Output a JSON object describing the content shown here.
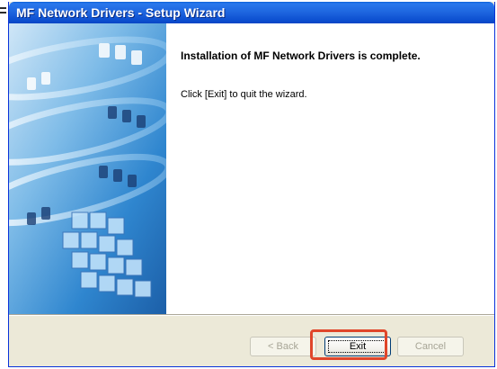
{
  "window": {
    "title": "MF Network Drivers - Setup Wizard"
  },
  "main": {
    "heading": "Installation of MF Network Drivers is complete.",
    "message": "Click [Exit] to quit the wizard."
  },
  "buttons": {
    "back": {
      "label": "< Back",
      "enabled": false
    },
    "exit": {
      "label": "Exit",
      "enabled": true,
      "focused": true
    },
    "cancel": {
      "label": "Cancel",
      "enabled": false
    }
  },
  "colors": {
    "titlebar": "#1f67e0",
    "highlight": "#e0462a",
    "banner": "#3d8fd4"
  }
}
